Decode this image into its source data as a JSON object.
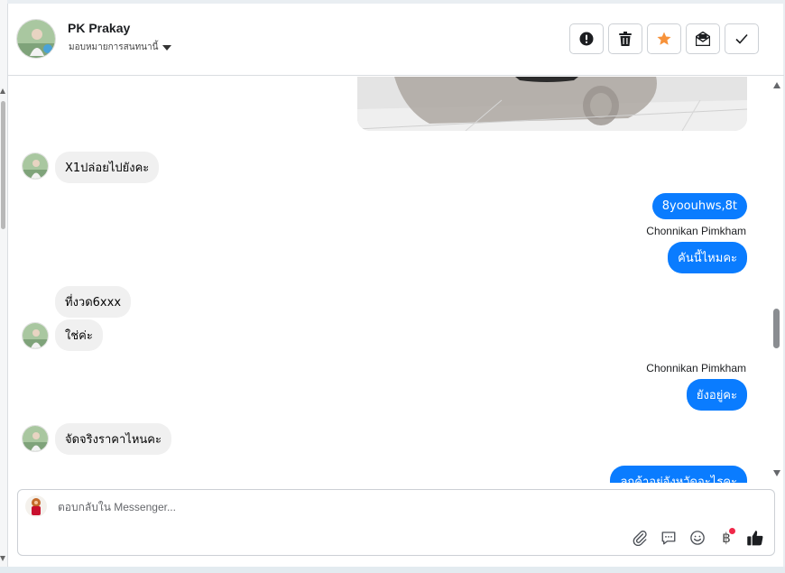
{
  "header": {
    "contact_name": "PK Prakay",
    "assign_label": "มอบหมายการสนทนานี้",
    "actions": [
      {
        "name": "mark-spam-button",
        "icon": "alert-icon"
      },
      {
        "name": "delete-button",
        "icon": "trash-icon"
      },
      {
        "name": "star-button",
        "icon": "star-icon",
        "color": "#f7923a"
      },
      {
        "name": "mark-unread-button",
        "icon": "envelope-icon"
      },
      {
        "name": "mark-done-button",
        "icon": "check-icon"
      }
    ]
  },
  "messages": [
    {
      "dir": "in",
      "text": "X1ปล่อยไปยังคะ"
    },
    {
      "dir": "out",
      "text": "8yoouhws,8t"
    },
    {
      "dir": "out",
      "sender": "Chonnikan Pimkham",
      "text": "คันนี้ไหมคะ"
    },
    {
      "dir": "in",
      "text": "ที่งวด6xxx"
    },
    {
      "dir": "in",
      "text": "ใช่ค่ะ"
    },
    {
      "dir": "out",
      "sender": "Chonnikan Pimkham",
      "text": "ยังอยู่คะ"
    },
    {
      "dir": "in",
      "text": "จัดจริงราคาไหนคะ"
    },
    {
      "dir": "out",
      "text": "ลูกค้าอยู่จังหวัดอะไรคะ"
    }
  ],
  "composer": {
    "placeholder": "ตอบกลับใน Messenger...",
    "tools": [
      "attach-icon",
      "saved-replies-icon",
      "emoji-icon",
      "baht-icon",
      "like-icon"
    ],
    "baht_symbol": "฿"
  },
  "colors": {
    "outgoing_bubble": "#0a7cff",
    "incoming_bubble": "#f0f0f0",
    "notification_dot": "#f02849"
  }
}
